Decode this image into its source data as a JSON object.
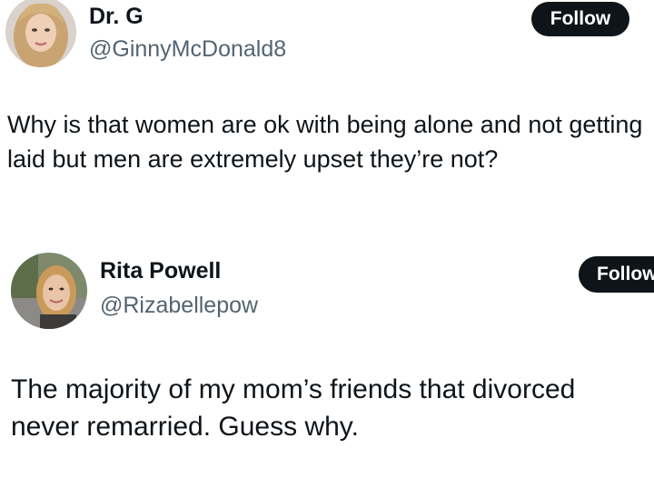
{
  "tweets": [
    {
      "display_name": "Dr. G",
      "handle": "@GinnyMcDonald8",
      "follow_label": "Follow",
      "avatar_icon": "avatar-photo-woman-blonde",
      "text": "Why is that women are ok with being alone and not getting laid but men are extremely upset they’re not?"
    },
    {
      "display_name": "Rita Powell",
      "handle": "@Rizabellepow",
      "follow_label": "Follow",
      "avatar_icon": "avatar-photo-woman-outdoor",
      "text": "The majority of my mom’s friends that divorced never remarried. Guess why."
    }
  ],
  "colors": {
    "follow_button_bg": "#0f1419",
    "follow_button_text": "#ffffff",
    "handle_text": "#536471",
    "body_text": "#0f1419",
    "border_tint": "#efc9db"
  }
}
